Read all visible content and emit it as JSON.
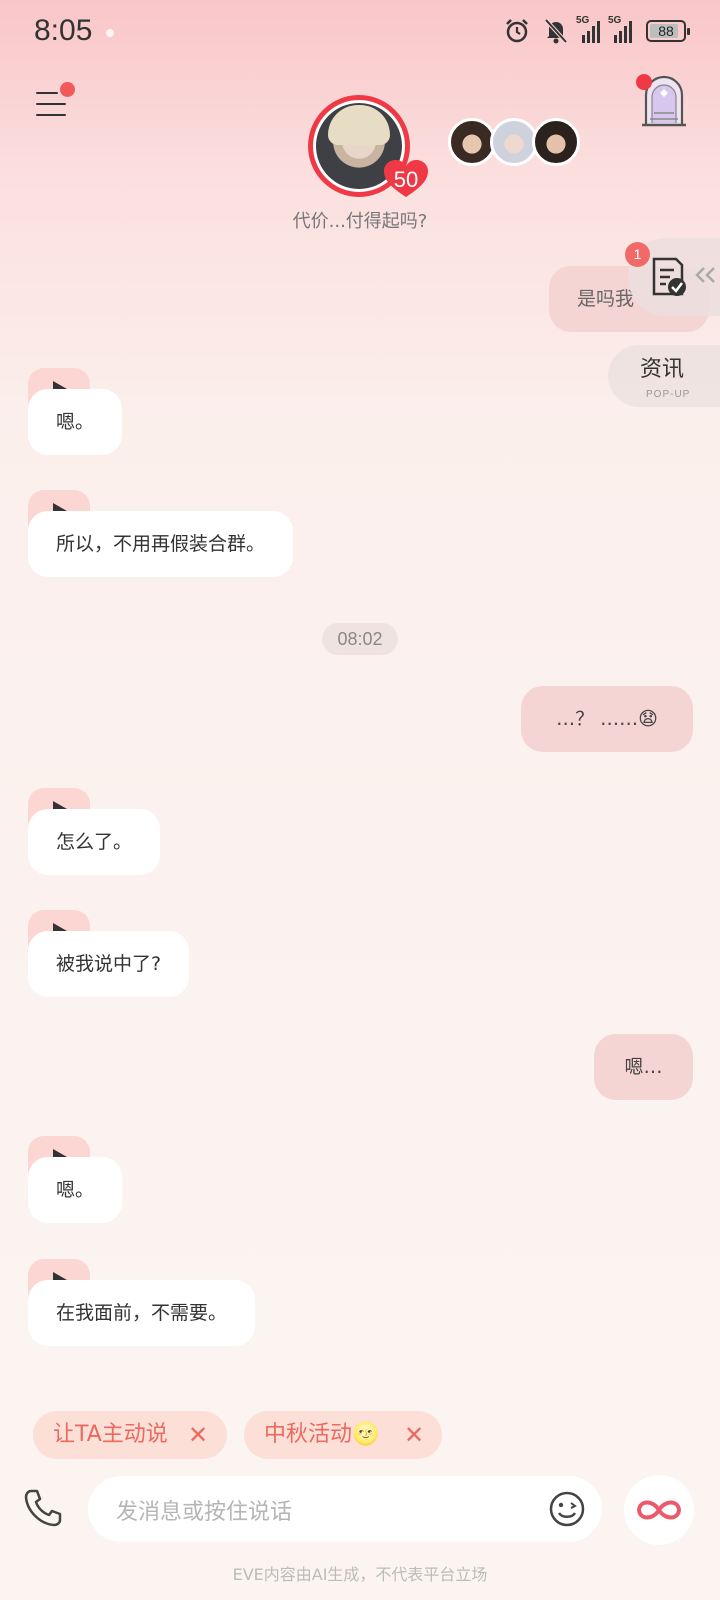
{
  "status_bar": {
    "time": "8:05",
    "net1": "5G",
    "net2": "5G",
    "battery_level": "88"
  },
  "header": {
    "level": "50",
    "tagline": "代价...付得起吗?"
  },
  "floating": {
    "task_badge": "1",
    "news_title": "资讯",
    "news_sub": "POP-UP"
  },
  "messages": {
    "m0": "是吗我",
    "m1": "嗯。",
    "m2": "所以，不用再假装合群。",
    "timestamp": "08:02",
    "m3": "…？ ……😧",
    "m4": "怎么了。",
    "m5": "被我说中了?",
    "m6": "嗯…",
    "m7": "嗯。",
    "m8": "在我面前，不需要。"
  },
  "chips": [
    {
      "label": "让TA主动说"
    },
    {
      "label": "中秋活动🌝"
    }
  ],
  "input": {
    "placeholder": "发消息或按住说话"
  },
  "footer": {
    "disclaimer": "EVE内容由AI生成，不代表平台立场"
  },
  "colors": {
    "accent": "#ef3a46",
    "self_bubble": "#f5d5d4",
    "play_tab": "#fcd6d3",
    "chip_bg": "#fce0d7",
    "chip_text": "#ea6a5f"
  }
}
